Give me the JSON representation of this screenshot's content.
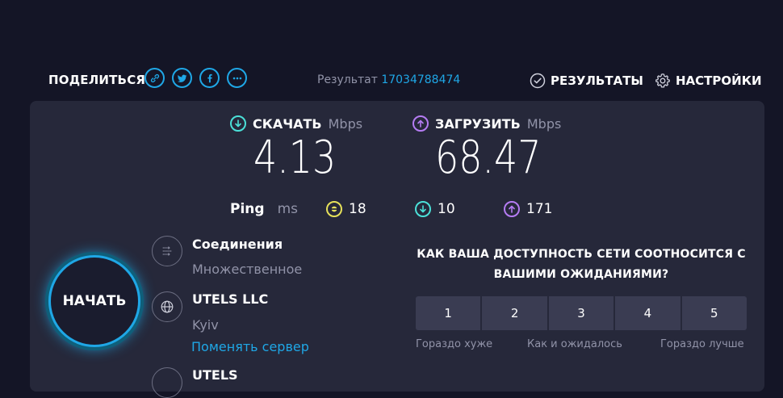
{
  "header": {
    "share_label": "ПОДЕЛИТЬСЯ",
    "share_icons": [
      "link-icon",
      "twitter-icon",
      "facebook-icon",
      "more-icon"
    ],
    "result_label": "Результат",
    "result_id": "17034788474",
    "nav": [
      {
        "label": "РЕЗУЛЬТАТЫ",
        "icon": "check-circle-icon"
      },
      {
        "label": "НАСТРОЙКИ",
        "icon": "gear-icon"
      }
    ]
  },
  "download": {
    "label": "СКАЧАТЬ",
    "unit": "Mbps",
    "value": "4.13",
    "icon_color": "#4be0d8"
  },
  "upload": {
    "label": "ЗАГРУЗИТЬ",
    "unit": "Mbps",
    "value": "68.47",
    "icon_color": "#b57cf3"
  },
  "ping": {
    "label": "Ping",
    "unit": "ms",
    "idle": "18",
    "download": "10",
    "upload": "171"
  },
  "start_button": "НАЧАТЬ",
  "connections": {
    "title": "Соединения",
    "value": "Множественное"
  },
  "server": {
    "provider": "UTELS LLC",
    "city": "Kyiv",
    "change_link": "Поменять сервер"
  },
  "server2": {
    "provider": "UTELS"
  },
  "survey": {
    "question": "КАК ВАША ДОСТУПНОСТЬ СЕТИ СООТНОСИТСЯ С ВАШИМИ ОЖИДАНИЯМИ?",
    "options": [
      "1",
      "2",
      "3",
      "4",
      "5"
    ],
    "scale_low": "Гораздо хуже",
    "scale_mid": "Как и ожидалось",
    "scale_high": "Гораздо лучше"
  },
  "colors": {
    "accent": "#1fa7e6",
    "download": "#4be0d8",
    "upload": "#b57cf3",
    "ping": "#e7e25a"
  }
}
